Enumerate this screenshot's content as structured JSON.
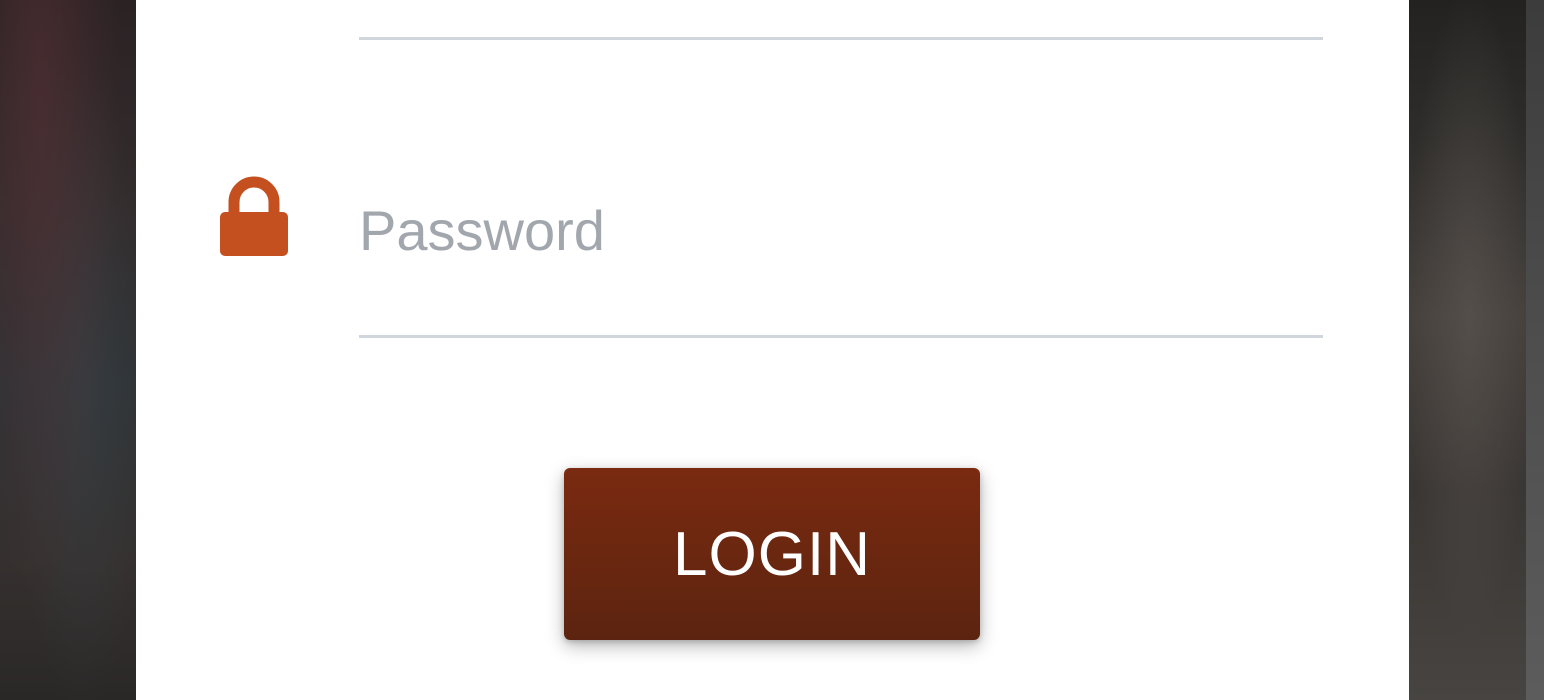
{
  "login_form": {
    "password_placeholder": "Password",
    "password_value": "",
    "login_label": "LOGIN"
  },
  "icons": {
    "lock": "lock-icon"
  },
  "colors": {
    "accent": "#c4501f",
    "button": "#6b2812",
    "placeholder": "#a2a7ae",
    "underline": "#d1d6dc"
  }
}
